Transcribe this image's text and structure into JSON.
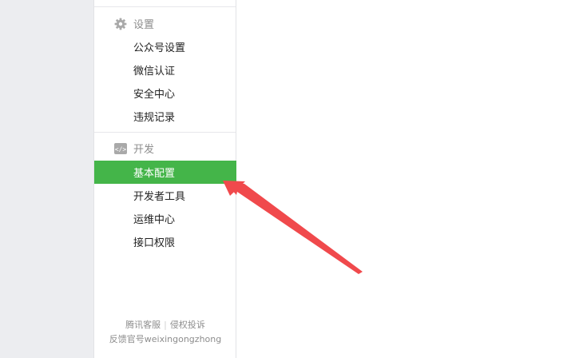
{
  "sidebar": {
    "settings_section": {
      "title": "设置",
      "icon": "gear-icon",
      "items": [
        {
          "label": "公众号设置"
        },
        {
          "label": "微信认证"
        },
        {
          "label": "安全中心"
        },
        {
          "label": "违规记录"
        }
      ]
    },
    "develop_section": {
      "title": "开发",
      "icon": "code-icon",
      "items": [
        {
          "label": "基本配置",
          "active": true
        },
        {
          "label": "开发者工具"
        },
        {
          "label": "运维中心"
        },
        {
          "label": "接口权限"
        }
      ]
    },
    "footer": {
      "link_service": "腾讯客服",
      "separator": "|",
      "link_complaint": "侵权投诉",
      "feedback": "反馈官号weixingongzhong"
    }
  },
  "colors": {
    "accent": "#44b549",
    "annotation_arrow": "#f0494c"
  }
}
